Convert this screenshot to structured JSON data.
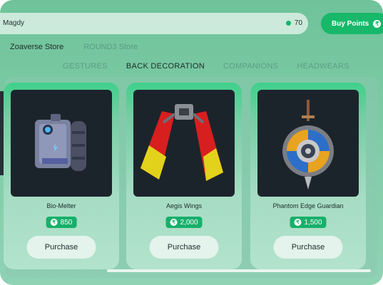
{
  "header": {
    "username": "Magdy",
    "points": "70",
    "buy_label": "Buy Points"
  },
  "stores": [
    "Zoaverse Store",
    "ROUND3 Store"
  ],
  "categories": [
    "GESTURES",
    "BACK DECORATION",
    "COMPANIONS",
    "HEADWEARS"
  ],
  "items": [
    {
      "name": "Bio-Melter",
      "price": "850",
      "button": "Purchase"
    },
    {
      "name": "Aegis Wings",
      "price": "2,000",
      "button": "Purchase"
    },
    {
      "name": "Phantom Edge Guardian",
      "price": "1,500",
      "button": "Purchase"
    }
  ],
  "colors": {
    "accent": "#17b86a",
    "card_image_bg": "#1c242b"
  }
}
